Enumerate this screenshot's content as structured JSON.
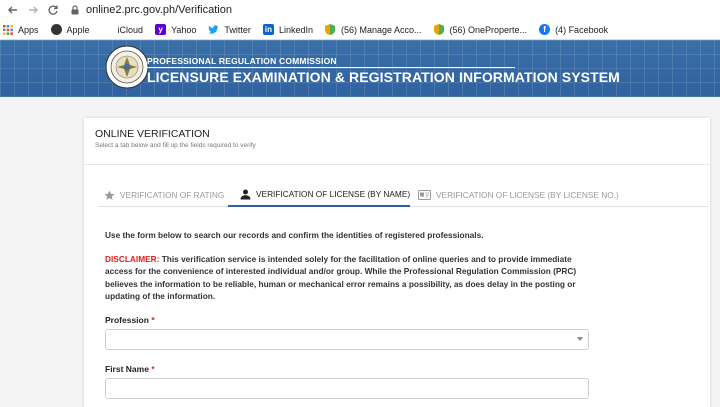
{
  "browser": {
    "url": "online2.prc.gov.ph/Verification",
    "bookmarks": [
      {
        "label": "Apps",
        "icon": "apps-grid-icon",
        "color": "#e94235"
      },
      {
        "label": "Apple",
        "icon": "apple-icon",
        "color": "#333333"
      },
      {
        "label": "iCloud",
        "icon": "icloud-icon",
        "color": "#555555"
      },
      {
        "label": "Yahoo",
        "icon": "yahoo-icon",
        "color": "#5f01d1"
      },
      {
        "label": "Twitter",
        "icon": "twitter-icon",
        "color": "#1da1f2"
      },
      {
        "label": "LinkedIn",
        "icon": "linkedin-icon",
        "color": "#0a66c2"
      },
      {
        "label": "(56) Manage Acco...",
        "icon": "shield-icon",
        "color": "#e8a400"
      },
      {
        "label": "(56) OneProperte...",
        "icon": "shield-icon",
        "color": "#e8a400"
      },
      {
        "label": "(4) Facebook",
        "icon": "facebook-icon",
        "color": "#1877f2"
      }
    ]
  },
  "header": {
    "agency": "PROFESSIONAL REGULATION COMMISSION",
    "system": "LICENSURE EXAMINATION & REGISTRATION INFORMATION SYSTEM",
    "brand_color": "#2f62a0"
  },
  "card": {
    "title": "ONLINE VERIFICATION",
    "subtitle": "Select a tab below and fill up the fields required to verify",
    "tabs": [
      {
        "label": "VERIFICATION OF RATING",
        "icon": "star-icon",
        "active": false
      },
      {
        "label": "VERIFICATION OF LICENSE (BY NAME)",
        "icon": "person-icon",
        "active": true
      },
      {
        "label": "VERIFICATION OF LICENSE (BY LICENSE NO.)",
        "icon": "id-card-icon",
        "active": false
      }
    ],
    "intro": "Use the form below to search our records and confirm the identities of registered professionals.",
    "disclaimer_label": "DISCLAIMER:",
    "disclaimer_text": "This verification service is intended solely for the facilitation of online queries and to provide immediate access for the convenience of interested individual and/or group. While the Professional Regulation Commission (PRC) believes the information to be reliable, human or mechanical error remains a possibility, as does delay in the posting or updating of the information.",
    "fields": {
      "profession": {
        "label": "Profession",
        "required_mark": "*",
        "value": ""
      },
      "first_name": {
        "label": "First Name",
        "required_mark": "*",
        "value": ""
      }
    }
  }
}
